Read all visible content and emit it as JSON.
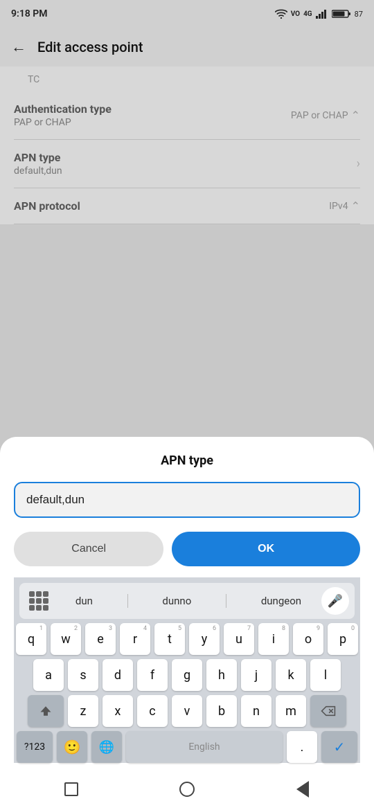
{
  "statusBar": {
    "time": "9:18 PM",
    "batteryLevel": "87"
  },
  "topNav": {
    "title": "Edit access point",
    "backLabel": "←"
  },
  "bgRows": [
    {
      "id": "partial",
      "label": "TC",
      "sublabel": ""
    },
    {
      "id": "auth-type",
      "label": "Authentication type",
      "sublabel": "PAP or CHAP",
      "value": "PAP or CHAP",
      "hasDropdown": true
    },
    {
      "id": "apn-type",
      "label": "APN type",
      "sublabel": "default,dun",
      "value": "",
      "hasArrow": true
    },
    {
      "id": "apn-protocol",
      "label": "APN protocol",
      "sublabel": "",
      "value": "IPv4",
      "hasDropdown": true
    }
  ],
  "dialog": {
    "title": "APN type",
    "inputValue": "default,dun",
    "inputPlaceholder": "default,dun",
    "cancelLabel": "Cancel",
    "okLabel": "OK"
  },
  "keyboard": {
    "suggestions": [
      "dun",
      "dunno",
      "dungeon"
    ],
    "rows": [
      [
        "q",
        "w",
        "e",
        "r",
        "t",
        "y",
        "u",
        "i",
        "o",
        "p"
      ],
      [
        "a",
        "s",
        "d",
        "f",
        "g",
        "h",
        "j",
        "k",
        "l"
      ],
      [
        "z",
        "x",
        "c",
        "v",
        "b",
        "n",
        "m"
      ]
    ],
    "numbers": [
      "1",
      "2",
      "3",
      "4",
      "5",
      "6",
      "7",
      "8",
      "9",
      "0"
    ],
    "bottomLeft": "?123",
    "spaceLabel": "English",
    "period": "."
  }
}
